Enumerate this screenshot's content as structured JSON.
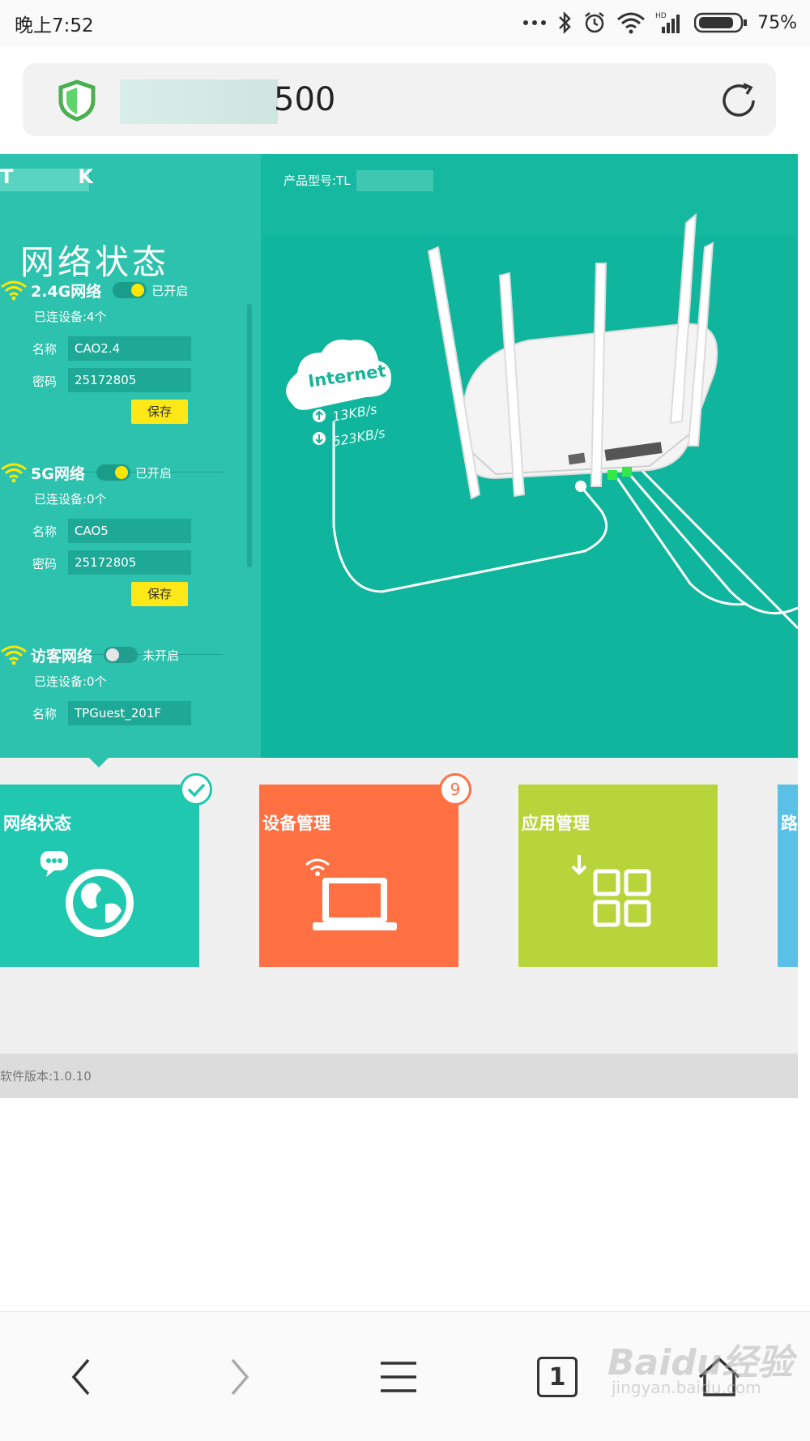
{
  "status_bar": {
    "time": "晚上7:52",
    "battery": "75%"
  },
  "url_bar": {
    "url_visible": "500"
  },
  "sidebar": {
    "logo": "TK",
    "title": "网络状态",
    "networks": [
      {
        "name": "2.4G网络",
        "toggle_state": "已开启",
        "enabled": true,
        "connected": "已连设备:4个",
        "name_label": "名称",
        "ssid": "CAO2.4",
        "password_label": "密码",
        "password": "25172805",
        "save_label": "保存"
      },
      {
        "name": "5G网络",
        "toggle_state": "已开启",
        "enabled": true,
        "connected": "已连设备:0个",
        "name_label": "名称",
        "ssid": "CAO5",
        "password_label": "密码",
        "password": "25172805",
        "save_label": "保存"
      },
      {
        "name": "访客网络",
        "toggle_state": "未开启",
        "enabled": false,
        "connected": "已连设备:0个",
        "name_label": "名称",
        "ssid": "TPGuest_201F"
      }
    ]
  },
  "main": {
    "model_label": "产品型号:TL",
    "internet_label": "Internet",
    "upload_speed": "13KB/s",
    "download_speed": "523KB/s"
  },
  "tiles": [
    {
      "label": "网络状态",
      "color": "#20c8b0"
    },
    {
      "label": "设备管理",
      "color": "#ff7043",
      "badge": "9"
    },
    {
      "label": "应用管理",
      "color": "#b7d43a"
    },
    {
      "label": "路",
      "color": "#5bc0e6"
    }
  ],
  "footer": {
    "version": "软件版本:1.0.10"
  },
  "nav": {
    "tab_count": "1"
  },
  "watermark": {
    "logo": "Baidu经验",
    "url": "jingyan.baidu.com"
  }
}
